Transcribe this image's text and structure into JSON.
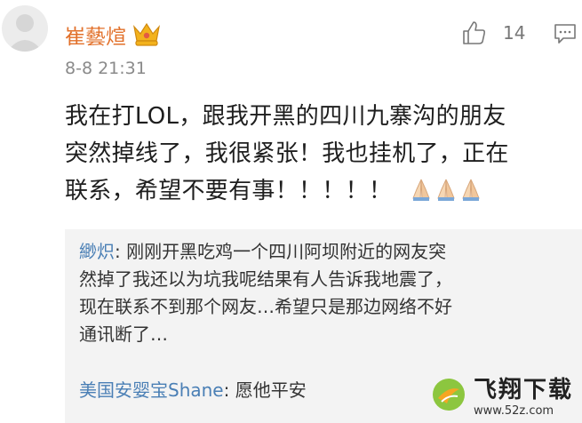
{
  "comment": {
    "username": "崔藝煊",
    "badge_icon": "crown-badge-icon",
    "timestamp": "8-8 21:31",
    "likes": "14",
    "lines": [
      "我在打LOL，跟我开黑的四川九寨沟的朋友",
      "突然掉线了，我很紧张！我也挂机了，正在",
      "联系，希望不要有事！！！！！"
    ],
    "emoji": [
      "folded-hands-icon",
      "folded-hands-icon",
      "folded-hands-icon"
    ]
  },
  "replies": [
    {
      "user": "緲炽",
      "text": "刚刚开黑吃鸡一个四川阿坝附近的网友突然掉了我还以为坑我呢结果有人告诉我地震了，现在联系不到那个网友…希望只是那边网络不好通讯断了…"
    },
    {
      "user": "美国安婴宝Shane",
      "text": "愿他平安"
    }
  ],
  "watermark": {
    "title": "飞翔下载",
    "url": "www.52z.com"
  },
  "colors": {
    "username": "#e2702a",
    "reply_user": "#4a7fb5",
    "reply_bg": "#f3f3f3"
  }
}
